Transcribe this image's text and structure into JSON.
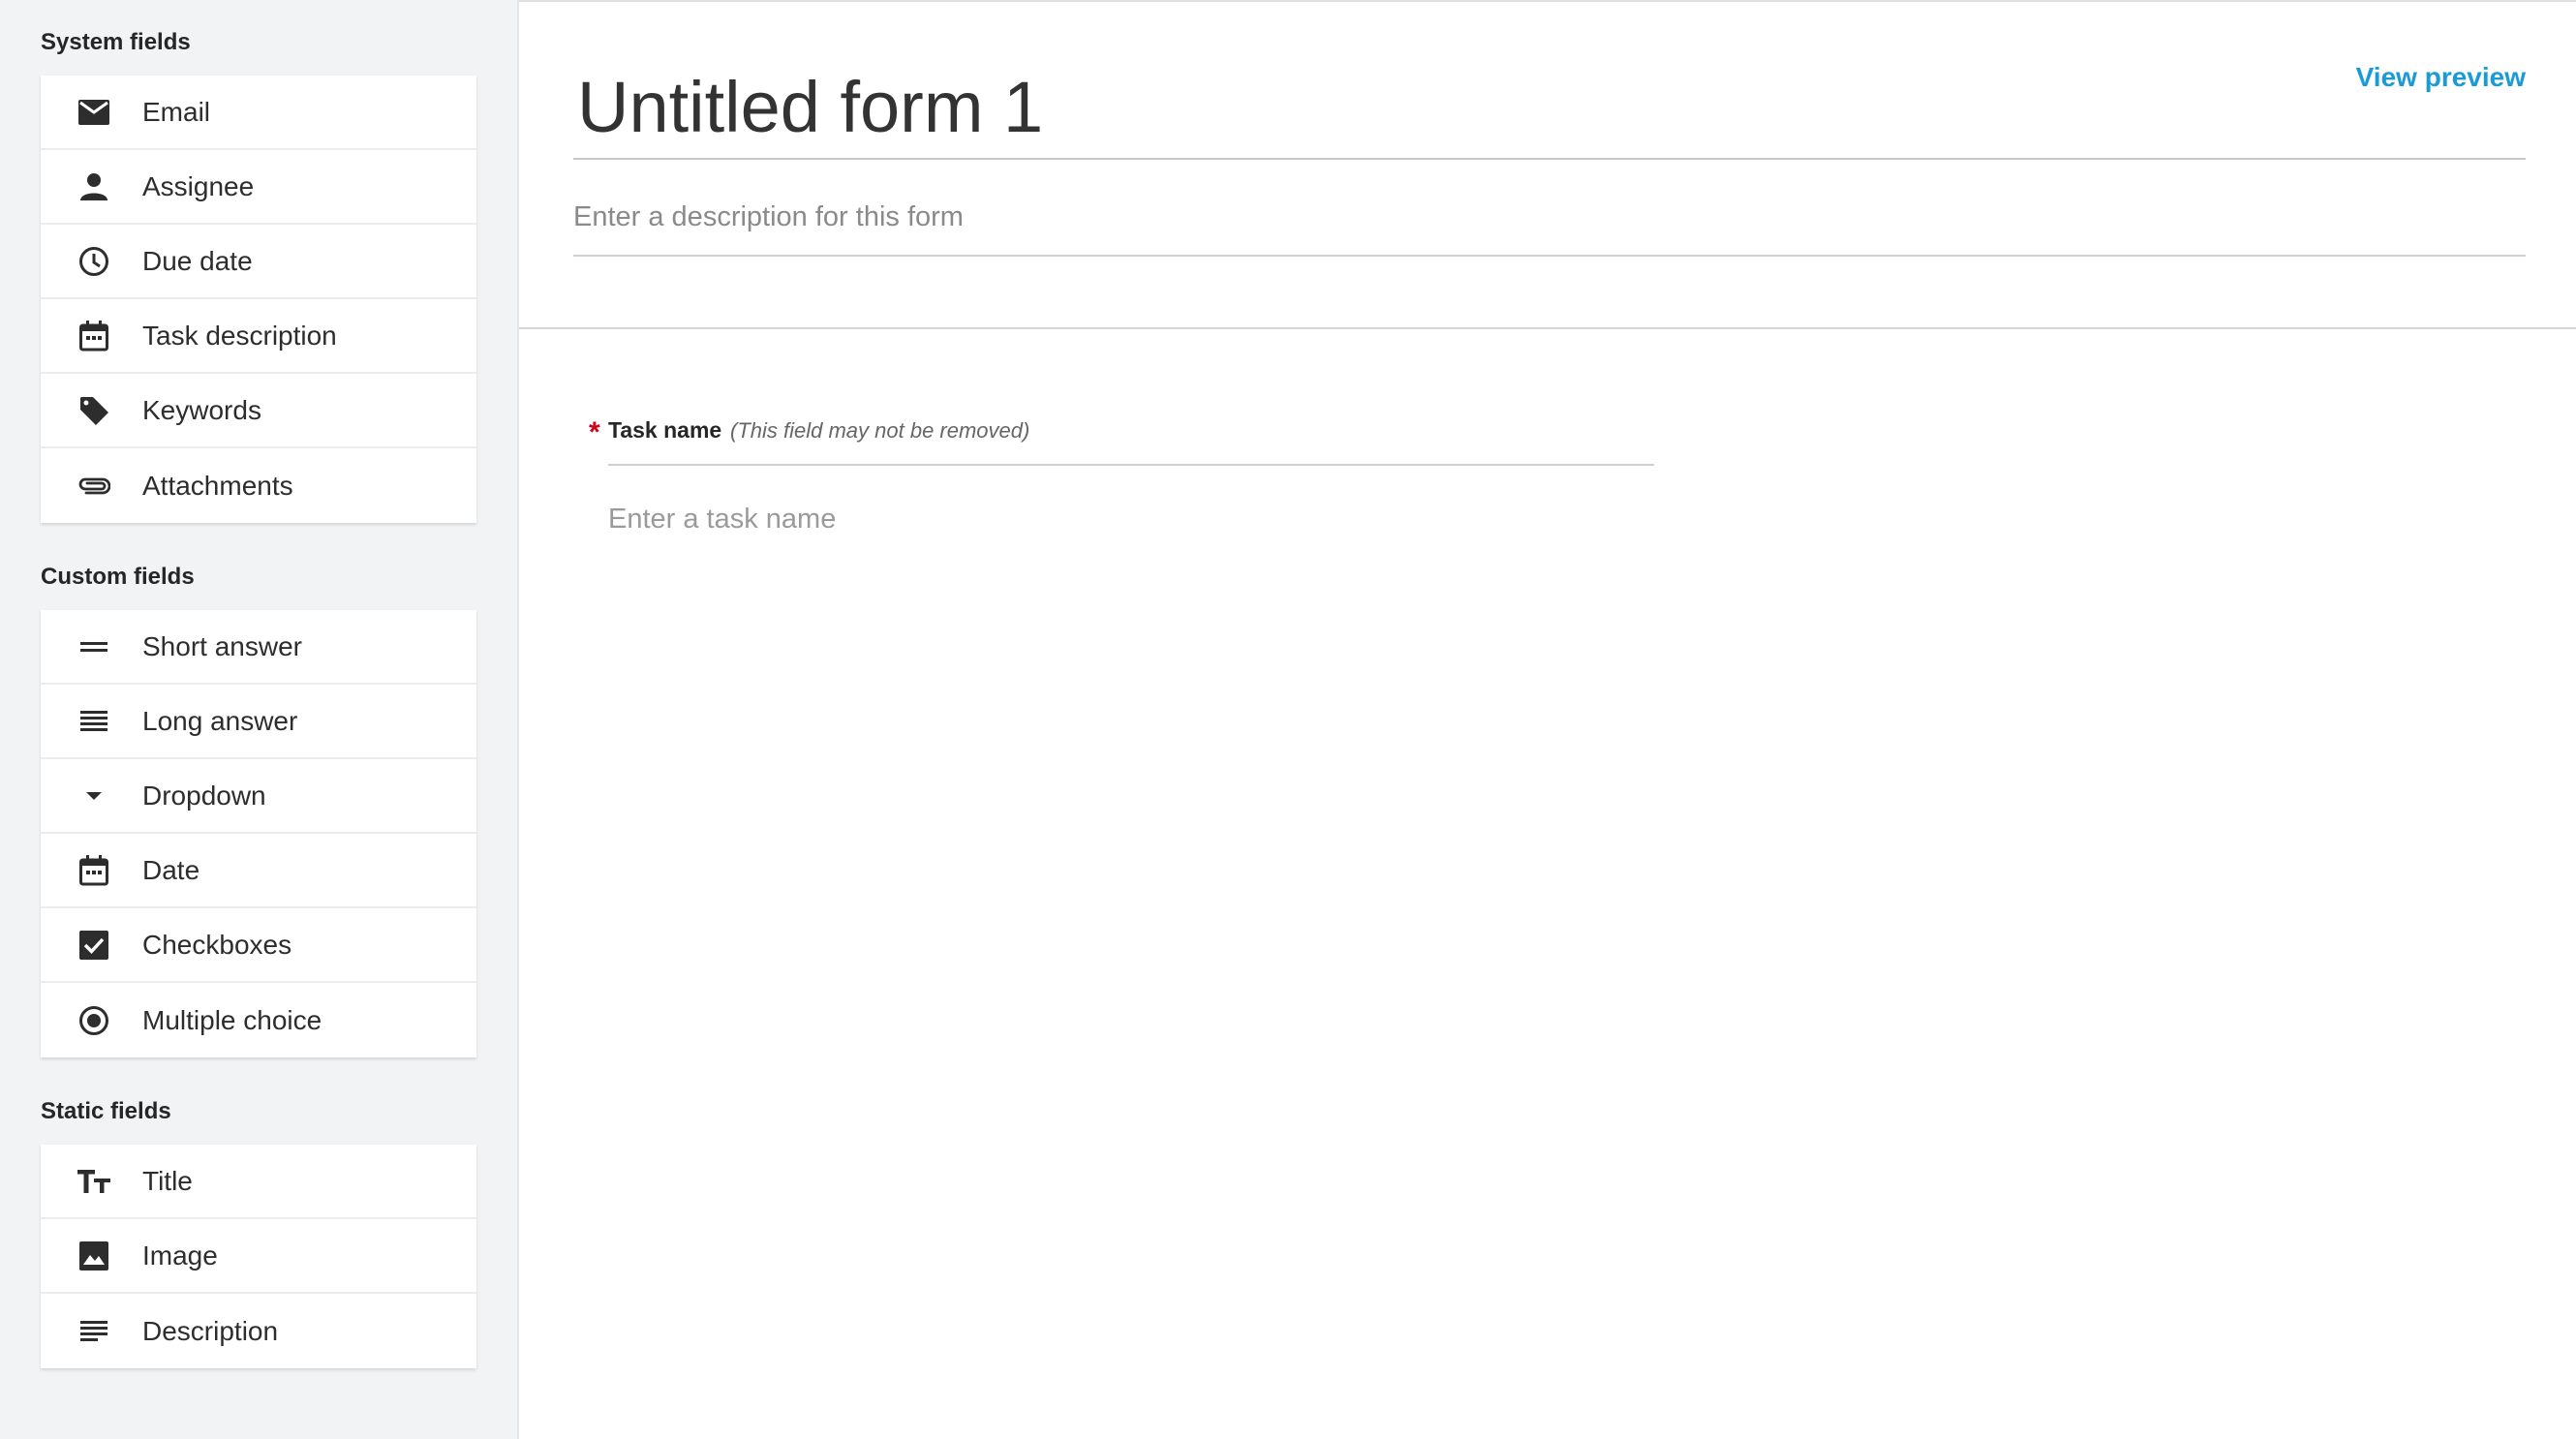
{
  "sidebar": {
    "system": {
      "title": "System fields",
      "items": [
        {
          "label": "Email",
          "icon": "email-icon"
        },
        {
          "label": "Assignee",
          "icon": "person-icon"
        },
        {
          "label": "Due date",
          "icon": "clock-icon"
        },
        {
          "label": "Task description",
          "icon": "calendar-icon"
        },
        {
          "label": "Keywords",
          "icon": "tag-icon"
        },
        {
          "label": "Attachments",
          "icon": "paperclip-icon"
        }
      ]
    },
    "custom": {
      "title": "Custom fields",
      "items": [
        {
          "label": "Short answer",
          "icon": "short-answer-icon"
        },
        {
          "label": "Long answer",
          "icon": "long-answer-icon"
        },
        {
          "label": "Dropdown",
          "icon": "caret-down-icon"
        },
        {
          "label": "Date",
          "icon": "calendar-icon"
        },
        {
          "label": "Checkboxes",
          "icon": "checkbox-icon"
        },
        {
          "label": "Multiple choice",
          "icon": "radio-icon"
        }
      ]
    },
    "static": {
      "title": "Static fields",
      "items": [
        {
          "label": "Title",
          "icon": "text-size-icon"
        },
        {
          "label": "Image",
          "icon": "image-icon"
        },
        {
          "label": "Description",
          "icon": "description-icon"
        }
      ]
    }
  },
  "form": {
    "title": "Untitled form 1",
    "view_preview": "View preview",
    "description_placeholder": "Enter a description for this form"
  },
  "task_field": {
    "required_marker": "*",
    "label": "Task name",
    "note": "(This field may not be removed)",
    "placeholder": "Enter a task name"
  },
  "colors": {
    "accent": "#1a9ad6",
    "required": "#d0021b",
    "sidebar_bg": "#f2f3f5"
  }
}
